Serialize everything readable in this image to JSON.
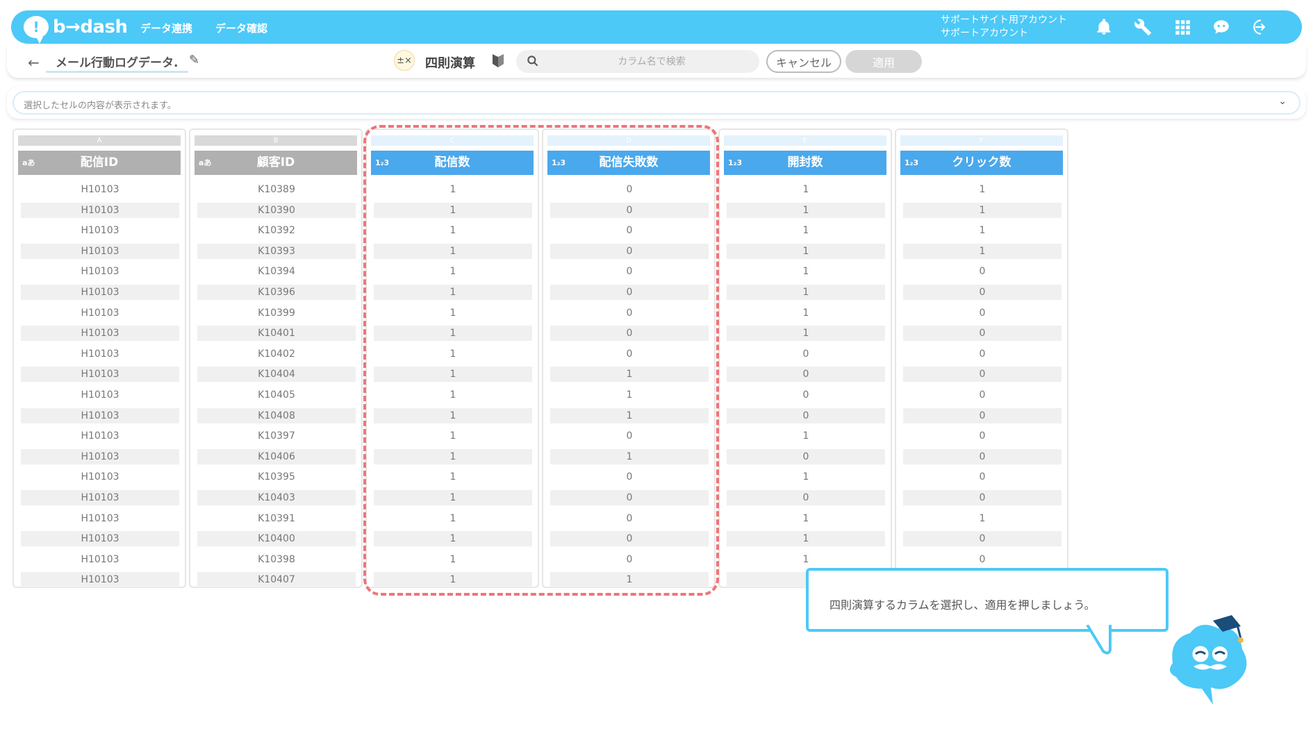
{
  "header": {
    "logo_text": "b→dash",
    "nav": [
      "データ連携",
      "データ確認"
    ],
    "account_line1": "サポートサイト用アカウント",
    "account_line2": "サポートアカウント",
    "accent_color": "#4cc9f7"
  },
  "toolbar": {
    "dataset_name": "メール行動ログデータ.",
    "operation_label": "四則演算",
    "search_placeholder": "カラム名で検索",
    "cancel_label": "キャンセル",
    "apply_label": "適用"
  },
  "cell_bar": {
    "text": "選択したセルの内容が表示されます。"
  },
  "columns": [
    {
      "letter": "A",
      "type": "aあ",
      "name": "配信ID",
      "numeric": false,
      "values": [
        "H10103",
        "H10103",
        "H10103",
        "H10103",
        "H10103",
        "H10103",
        "H10103",
        "H10103",
        "H10103",
        "H10103",
        "H10103",
        "H10103",
        "H10103",
        "H10103",
        "H10103",
        "H10103",
        "H10103",
        "H10103",
        "H10103",
        "H10103"
      ]
    },
    {
      "letter": "B",
      "type": "aあ",
      "name": "顧客ID",
      "numeric": false,
      "values": [
        "K10389",
        "K10390",
        "K10392",
        "K10393",
        "K10394",
        "K10396",
        "K10399",
        "K10401",
        "K10402",
        "K10404",
        "K10405",
        "K10408",
        "K10397",
        "K10406",
        "K10395",
        "K10403",
        "K10391",
        "K10400",
        "K10398",
        "K10407"
      ]
    },
    {
      "letter": "C",
      "type": "1₂3",
      "name": "配信数",
      "numeric": true,
      "values": [
        "1",
        "1",
        "1",
        "1",
        "1",
        "1",
        "1",
        "1",
        "1",
        "1",
        "1",
        "1",
        "1",
        "1",
        "1",
        "1",
        "1",
        "1",
        "1",
        "1"
      ]
    },
    {
      "letter": "D",
      "type": "1₂3",
      "name": "配信失敗数",
      "numeric": true,
      "values": [
        "0",
        "0",
        "0",
        "0",
        "0",
        "0",
        "0",
        "0",
        "0",
        "1",
        "1",
        "1",
        "0",
        "1",
        "0",
        "0",
        "0",
        "0",
        "0",
        "1"
      ]
    },
    {
      "letter": "E",
      "type": "1₂3",
      "name": "開封数",
      "numeric": true,
      "values": [
        "1",
        "1",
        "1",
        "1",
        "1",
        "1",
        "1",
        "1",
        "0",
        "0",
        "0",
        "0",
        "1",
        "0",
        "1",
        "0",
        "1",
        "1",
        "1",
        ""
      ]
    },
    {
      "letter": "F",
      "type": "1₂3",
      "name": "クリック数",
      "numeric": true,
      "values": [
        "1",
        "1",
        "1",
        "1",
        "0",
        "0",
        "0",
        "0",
        "0",
        "0",
        "0",
        "0",
        "0",
        "0",
        "0",
        "0",
        "1",
        "0",
        "0",
        ""
      ]
    }
  ],
  "guide": {
    "message": "四則演算するカラムを選択し、適用を押しましょう。"
  }
}
